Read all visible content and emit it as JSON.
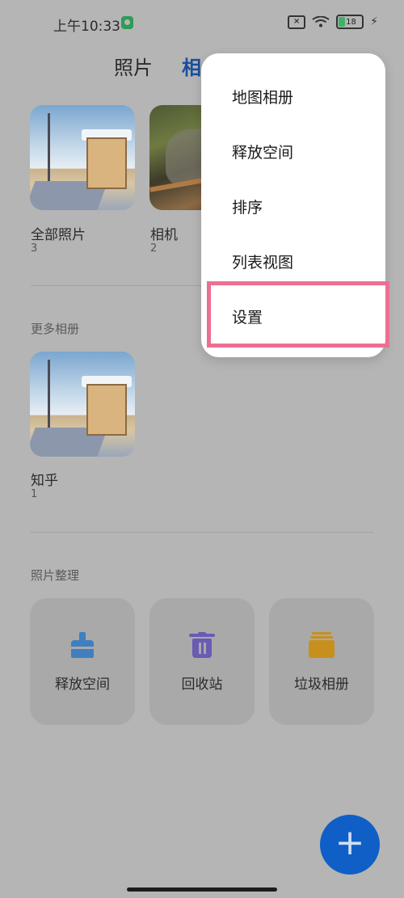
{
  "status_bar": {
    "time": "上午10:33",
    "battery_level": "18",
    "icons": [
      "shield-icon",
      "sim-off-icon",
      "wifi-icon",
      "battery-icon",
      "charging-icon"
    ]
  },
  "tabs": [
    {
      "label": "照片"
    },
    {
      "label": "相"
    }
  ],
  "albums": [
    {
      "name": "全部照片",
      "count": "3"
    },
    {
      "name": "相机",
      "count": "2"
    }
  ],
  "more_albums": {
    "title": "更多相册",
    "items": [
      {
        "name": "知乎",
        "count": "1"
      }
    ]
  },
  "organize": {
    "title": "照片整理",
    "cards": [
      {
        "label": "释放空间",
        "icon": "brush-icon",
        "color": "#3f7fc0"
      },
      {
        "label": "回收站",
        "icon": "trash-icon",
        "color": "#6a5bb3"
      },
      {
        "label": "垃圾相册",
        "icon": "box-icon",
        "color": "#c7901e"
      }
    ]
  },
  "fab": {
    "label": "+"
  },
  "menu": {
    "items": [
      {
        "label": "地图相册"
      },
      {
        "label": "释放空间"
      },
      {
        "label": "排序"
      },
      {
        "label": "列表视图"
      },
      {
        "label": "设置"
      }
    ],
    "highlight_color": "#ec6f92"
  }
}
